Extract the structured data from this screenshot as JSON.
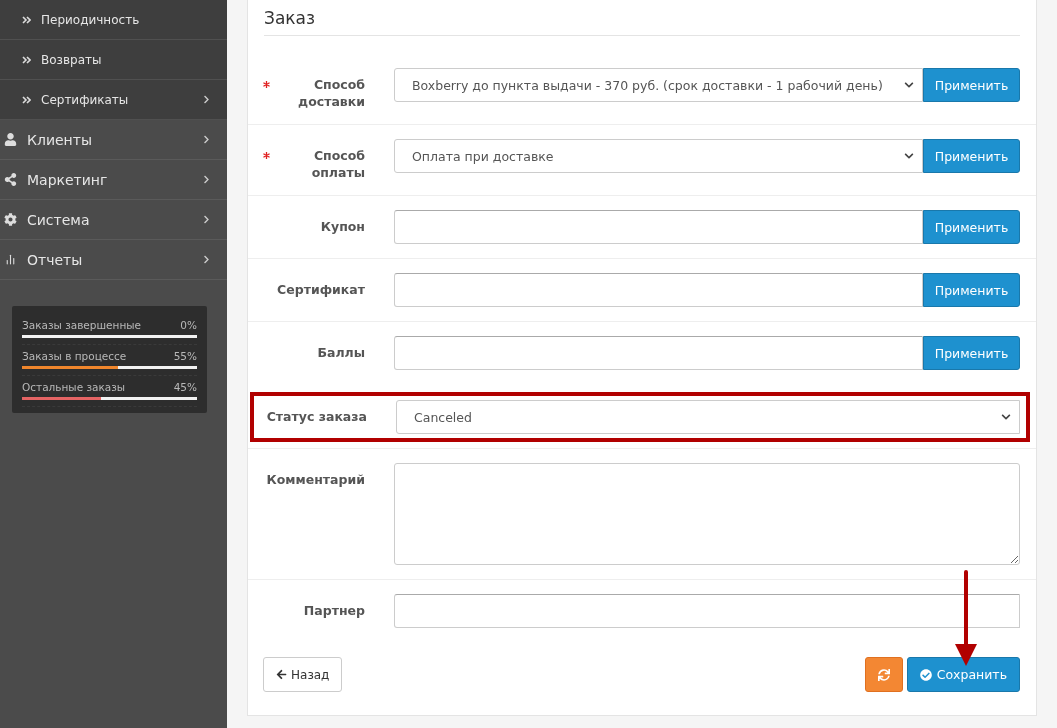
{
  "sidebar": {
    "items": [
      {
        "label": "Периодичность",
        "kind": "sub",
        "expandable": false
      },
      {
        "label": "Возвраты",
        "kind": "sub",
        "expandable": false
      },
      {
        "label": "Сертификаты",
        "kind": "sub",
        "expandable": true
      },
      {
        "label": "Клиенты",
        "kind": "main",
        "expandable": true
      },
      {
        "label": "Маркетинг",
        "kind": "main",
        "expandable": true
      },
      {
        "label": "Система",
        "kind": "main",
        "expandable": true
      },
      {
        "label": "Отчеты",
        "kind": "main",
        "expandable": true
      }
    ],
    "stats": [
      {
        "label": "Заказы завершенные",
        "value": "0%",
        "level": 0,
        "color": "#ffffff"
      },
      {
        "label": "Заказы в процессе",
        "value": "55%",
        "level": 0.55,
        "color": "#f0862c"
      },
      {
        "label": "Остальные заказы",
        "value": "45%",
        "level": 0.45,
        "color": "#e56464"
      }
    ]
  },
  "panel": {
    "title": "Заказ",
    "fields": [
      {
        "label": "Способ доставки",
        "required": true,
        "kind": "select",
        "value": "Boxberry до пункта выдачи - 370 руб. (срок доставки - 1 рабочий день)",
        "apply": "Применить",
        "highlighted": false
      },
      {
        "label": "Способ оплаты",
        "required": true,
        "kind": "select",
        "value": "Оплата при доставке",
        "apply": "Применить",
        "highlighted": false
      },
      {
        "label": "Купон",
        "required": false,
        "kind": "input",
        "apply": "Применить",
        "highlighted": false
      },
      {
        "label": "Сертификат",
        "required": false,
        "kind": "input",
        "apply": "Применить",
        "highlighted": false
      },
      {
        "label": "Баллы",
        "required": false,
        "kind": "input",
        "apply": "Применить",
        "highlighted": false
      },
      {
        "label": "Статус заказа",
        "required": false,
        "kind": "select",
        "value": "Canceled",
        "highlighted": true
      },
      {
        "label": "Комментарий",
        "required": false,
        "kind": "textarea",
        "highlighted": false
      },
      {
        "label": "Партнер",
        "required": false,
        "kind": "input",
        "highlighted": false
      }
    ],
    "back": "Назад",
    "save": "Сохранить"
  }
}
